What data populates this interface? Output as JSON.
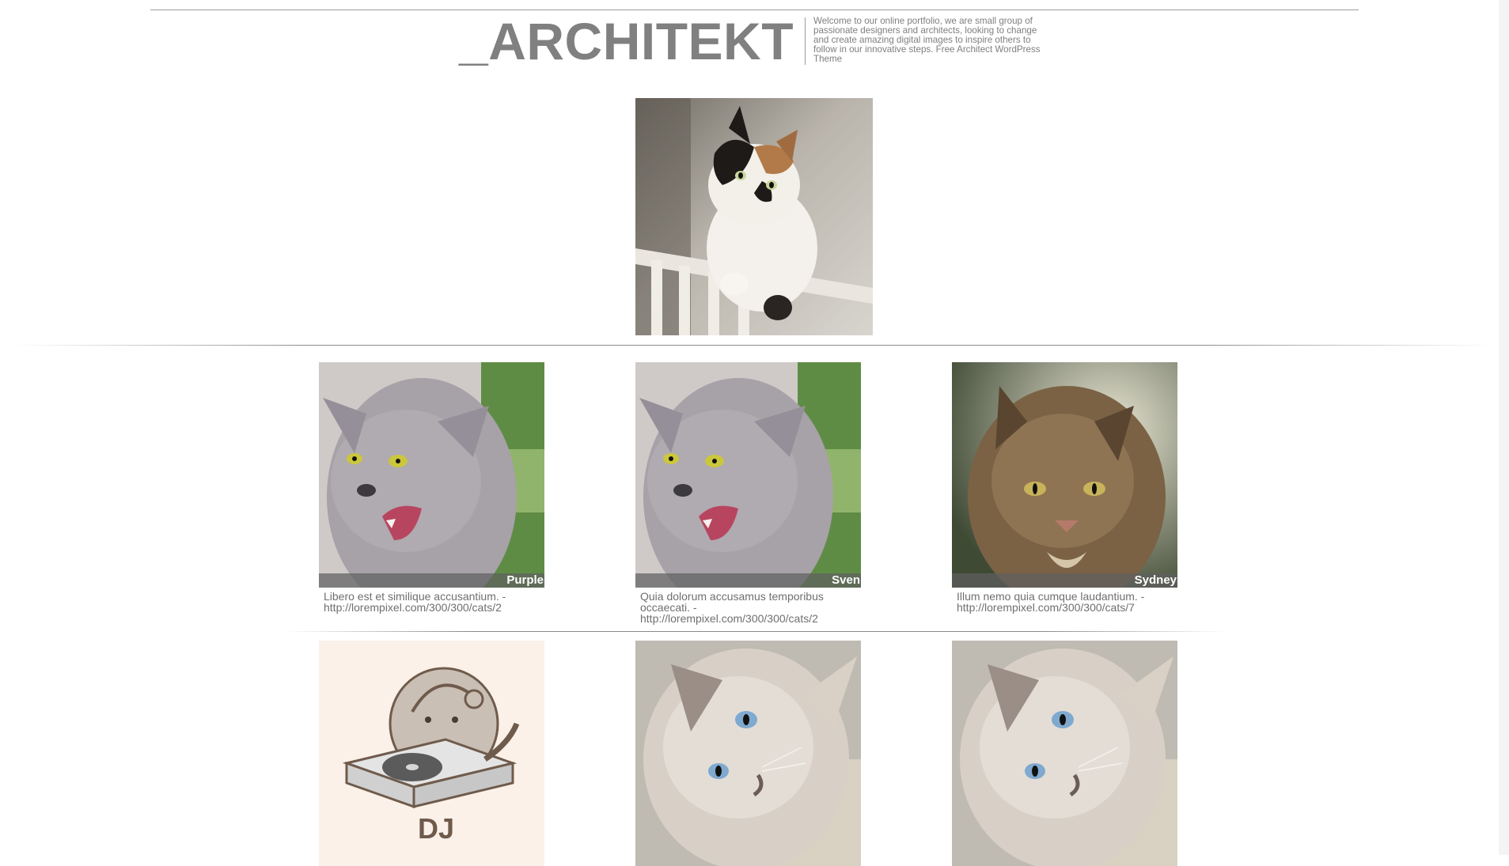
{
  "header": {
    "logo": "_ARCHITEKT",
    "tagline": "Welcome to our online portfolio, we are small group of passionate designers and architects, looking to change and create amazing digital images to inspire others to follow in our innovative steps. Free Architect WordPress Theme"
  },
  "hero": {
    "icon": "calico-cat-photo"
  },
  "gallery": {
    "row1": [
      {
        "name": "Purple",
        "caption": "Libero est et similique accusantium. - http://lorempixel.com/300/300/cats/2",
        "icon": "grey-hissing-cat-photo"
      },
      {
        "name": "Sven",
        "caption": "Quia dolorum accusamus temporibus occaecati. - http://lorempixel.com/300/300/cats/2",
        "icon": "grey-hissing-cat-photo"
      },
      {
        "name": "Sydney",
        "caption": "Illum nemo quia cumque laudantium. - http://lorempixel.com/300/300/cats/7",
        "icon": "tabby-cat-photo"
      }
    ],
    "row2": [
      {
        "icon": "pusheen-dj-cat-illustration",
        "illustration_text": "DJ"
      },
      {
        "icon": "siamese-cat-photo"
      },
      {
        "icon": "siamese-cat-photo"
      }
    ]
  },
  "colors": {
    "text": "#7f7f7f",
    "rule": "#9a9a9a",
    "label_bg": "#5f5f5f"
  }
}
